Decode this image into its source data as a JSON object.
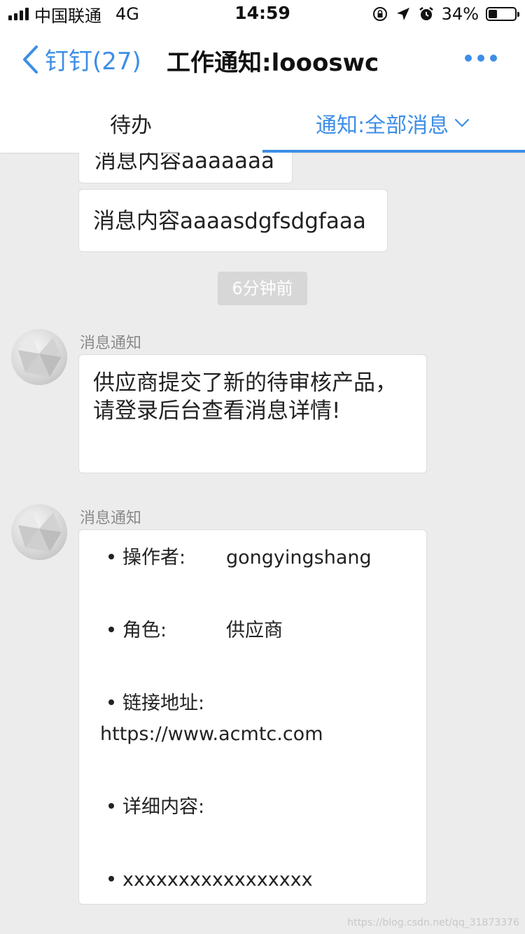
{
  "status": {
    "carrier": "中国联通",
    "network": "4G",
    "time": "14:59",
    "battery": "34%",
    "battery_level": 0.34
  },
  "nav": {
    "back_label": "钉钉(27)",
    "title": "工作通知:loooswc"
  },
  "tabs": {
    "todo": "待办",
    "notice": "通知:全部消息"
  },
  "messages": {
    "partial_top": "消息内容aaaaaaa",
    "msg2": "消息内容aaaasdgfsdgfaaa",
    "time_label": "6分钟前",
    "notice1": {
      "sender": "消息通知",
      "text": "供应商提交了新的待审核产品，请登录后台查看消息详情!"
    },
    "notice2": {
      "sender": "消息通知",
      "operator_key": "操作者:",
      "operator_val": "gongyingshang",
      "role_key": "角色:",
      "role_val": "供应商",
      "link_key": "链接地址:",
      "link_val": "https://www.acmtc.com",
      "detail_key": "详细内容:",
      "extra": "xxxxxxxxxxxxxxxxx"
    }
  },
  "watermark": "https://blog.csdn.net/qq_31873376",
  "colors": {
    "accent": "#3d8ee6",
    "background": "#ececec"
  }
}
